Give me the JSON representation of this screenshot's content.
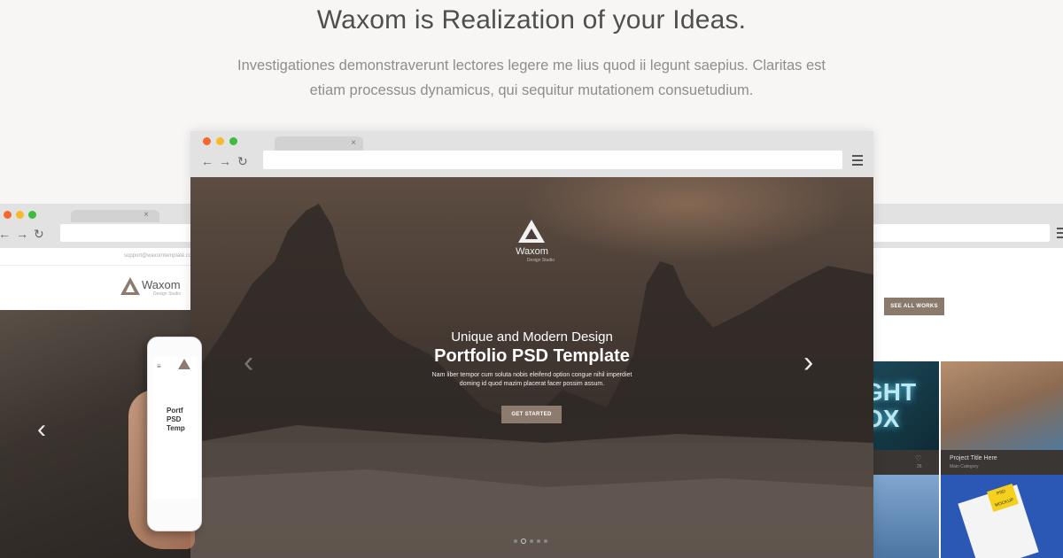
{
  "headline": "Waxom is Realization of your Ideas.",
  "subtext_line1": "Investigationes demonstraverunt lectores legere me lius quod ii legunt saepius. Claritas est",
  "subtext_line2": "etiam processus dynamicus, qui sequitur mutationem consuetudium.",
  "browser": {
    "tab_close": "×",
    "back": "←",
    "forward": "→",
    "reload": "↻"
  },
  "left_site": {
    "email": "support@waxomtemplate.com",
    "logo": "Waxom",
    "logo_sub": "Design Studio",
    "phone_title_1": "Portf",
    "phone_title_2": "PSD Temp"
  },
  "main_site": {
    "brand": "Waxom",
    "brand_sub": "Design Studio",
    "subtitle": "Unique and Modern Design",
    "title": "Portfolio PSD Template",
    "desc_line1": "Nam liber tempor cum soluta nobis eleifend option congue nihil imperdiet",
    "desc_line2": "doming id quod mazim placerat facer possim assum.",
    "cta": "GET STARTED",
    "prev": "‹",
    "next": "›"
  },
  "right_site": {
    "cta": "SEE ALL WORKS",
    "tile_text": "GHT\nOX",
    "project_title": "Project Title Here",
    "project_category": "Main Category",
    "likes": "26",
    "badge": "PSD MOCKUP"
  },
  "colors": {
    "background": "#f7f6f4",
    "cta": "#8c7b6e",
    "dot_red": "#f26a2c",
    "dot_yellow": "#f8b92b",
    "dot_green": "#3cbd3c"
  }
}
